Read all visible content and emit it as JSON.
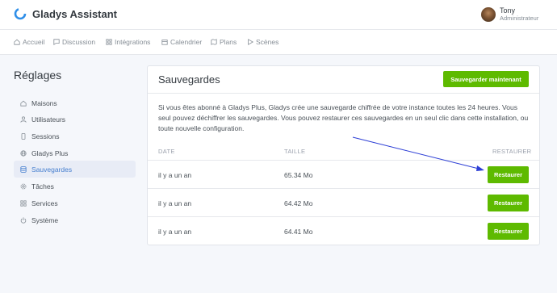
{
  "app": {
    "name": "Gladys Assistant"
  },
  "user": {
    "name": "Tony",
    "role": "Administrateur"
  },
  "nav": [
    {
      "label": "Accueil",
      "icon": "home-icon"
    },
    {
      "label": "Discussion",
      "icon": "message-icon"
    },
    {
      "label": "Intégrations",
      "icon": "grid-icon"
    },
    {
      "label": "Calendrier",
      "icon": "calendar-icon"
    },
    {
      "label": "Plans",
      "icon": "map-icon"
    },
    {
      "label": "Scènes",
      "icon": "play-icon"
    }
  ],
  "page": {
    "title": "Réglages"
  },
  "sidebar": [
    {
      "label": "Maisons",
      "icon": "home-icon"
    },
    {
      "label": "Utilisateurs",
      "icon": "user-icon"
    },
    {
      "label": "Sessions",
      "icon": "smartphone-icon"
    },
    {
      "label": "Gladys Plus",
      "icon": "globe-icon"
    },
    {
      "label": "Sauvegardes",
      "icon": "database-icon",
      "active": true
    },
    {
      "label": "Tâches",
      "icon": "settings-icon"
    },
    {
      "label": "Services",
      "icon": "services-icon"
    },
    {
      "label": "Système",
      "icon": "power-icon"
    }
  ],
  "backups": {
    "title": "Sauvegardes",
    "save_now_label": "Sauvegarder maintenant",
    "description": "Si vous êtes abonné à Gladys Plus, Gladys crée une sauvegarde chiffrée de votre instance toutes les 24 heures. Vous seul pouvez déchiffrer les sauvegardes. Vous pouvez restaurer ces sauvegardes en un seul clic dans cette installation, ou toute nouvelle configuration.",
    "columns": {
      "date": "DATE",
      "size": "TAILLE",
      "restore": "RESTAURER"
    },
    "rows": [
      {
        "date": "il y a un an",
        "size": "65.34 Mo",
        "action": "Restaurer"
      },
      {
        "date": "il y a un an",
        "size": "64.42 Mo",
        "action": "Restaurer"
      },
      {
        "date": "il y a un an",
        "size": "64.41 Mo",
        "action": "Restaurer"
      }
    ]
  },
  "colors": {
    "accent": "#467fcf",
    "success": "#5eba00",
    "annotation_arrow": "#2d3fd6"
  }
}
